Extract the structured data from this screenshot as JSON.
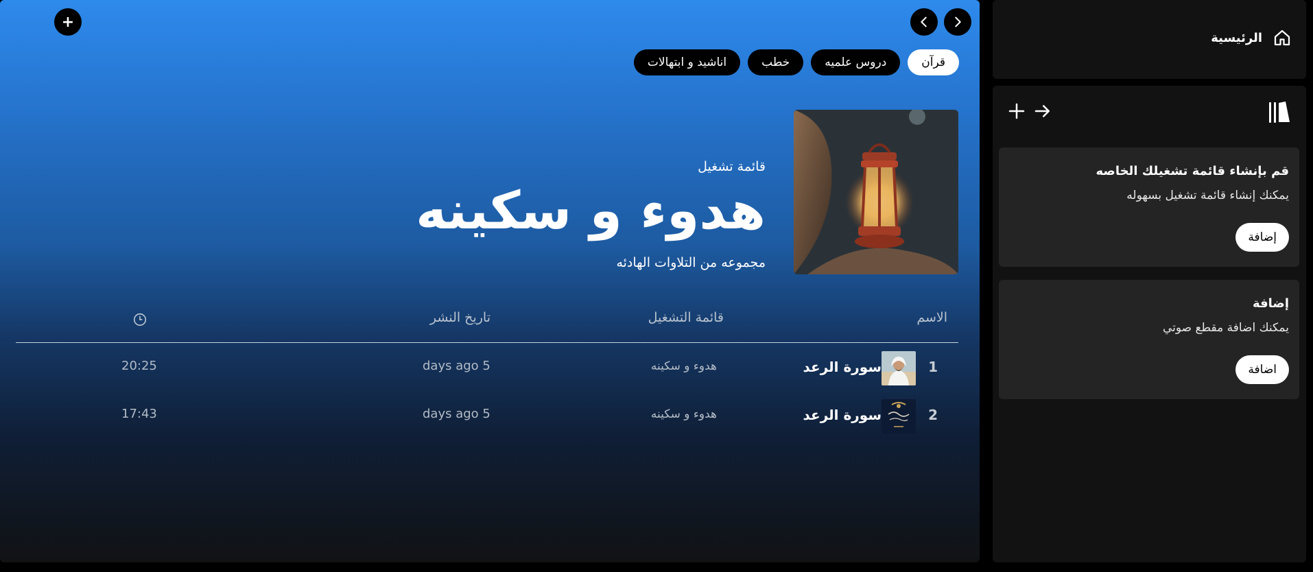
{
  "top_bar": {
    "plus_label": "+",
    "back_icon": "chevron-left-icon",
    "forward_icon": "chevron-right-icon"
  },
  "chips": [
    {
      "label": "قرآن",
      "active": true
    },
    {
      "label": "دروس علميه",
      "active": false
    },
    {
      "label": "خطب",
      "active": false
    },
    {
      "label": "اناشيد و ابتهالات",
      "active": false
    }
  ],
  "playlist": {
    "type_label": "قائمة تشغيل",
    "title": "هدوء و سكينه",
    "description": "مجموعه من التلاوات الهادئه",
    "cover_icon": "lantern-image"
  },
  "table": {
    "headers": {
      "name": "الاسم",
      "playlist": "قائمة التشغيل",
      "date": "تاريخ النشر",
      "duration_icon": "clock-icon"
    },
    "rows": [
      {
        "num": "1",
        "title": "سورة الرعد",
        "playlist": "هدوء و سكينه",
        "date": "days ago 5",
        "duration": "20:25"
      },
      {
        "num": "2",
        "title": "سورة الرعد",
        "playlist": "هدوء و سكينه",
        "date": "days ago 5",
        "duration": "17:43"
      }
    ]
  },
  "sidebar": {
    "home_label": "الرئيسية",
    "home_icon": "home-icon",
    "library_icon": "library-icon",
    "cards": [
      {
        "title": "قم بإنشاء قائمة تشغيلك الخاصه",
        "subtitle": "يمكنك إنشاء قائمة تشغيل بسهوله",
        "button": "إضافة"
      },
      {
        "title": "إضافة",
        "subtitle": "يمكنك اضافة مقطع صوتي",
        "button": "اضافة"
      }
    ]
  },
  "colors": {
    "gradient_top": "#2e8aec",
    "gradient_bottom": "#111214",
    "sidebar_bg": "#121212",
    "card_bg": "#242424"
  }
}
